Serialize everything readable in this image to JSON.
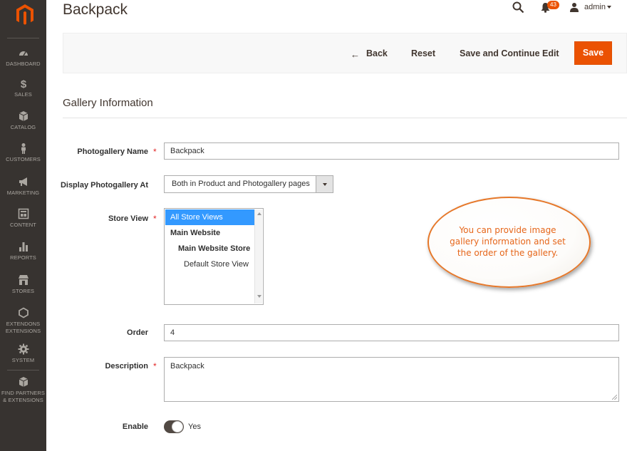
{
  "sidebar": {
    "items": [
      {
        "label": "DASHBOARD",
        "icon": "dashboard-icon"
      },
      {
        "label": "SALES",
        "icon": "dollar-icon"
      },
      {
        "label": "CATALOG",
        "icon": "cube-icon"
      },
      {
        "label": "CUSTOMERS",
        "icon": "person-icon"
      },
      {
        "label": "MARKETING",
        "icon": "megaphone-icon"
      },
      {
        "label": "CONTENT",
        "icon": "layout-icon"
      },
      {
        "label": "REPORTS",
        "icon": "bar-chart-icon"
      },
      {
        "label": "STORES",
        "icon": "store-icon"
      },
      {
        "label": "EXTENDONS",
        "label2": "EXTENSIONS",
        "icon": "hexagon-icon"
      },
      {
        "label": "SYSTEM",
        "icon": "gear-icon"
      },
      {
        "label": "FIND PARTNERS",
        "label2": "& EXTENSIONS",
        "icon": "box-icon"
      }
    ],
    "accent": "#eb5202",
    "background": "#373330"
  },
  "header": {
    "title": "Backpack",
    "notification_count": "43",
    "user": "admin"
  },
  "actions": {
    "back": "Back",
    "reset": "Reset",
    "save_continue": "Save and Continue Edit",
    "save": "Save"
  },
  "section": {
    "title": "Gallery Information"
  },
  "form": {
    "name_label": "Photogallery Name",
    "name_value": "Backpack",
    "display_label": "Display Photogallery At",
    "display_value": "Both in Product and Photogallery pages",
    "store_label": "Store View",
    "store_options": [
      "All Store Views",
      "Main Website",
      "Main Website Store",
      "Default Store View"
    ],
    "order_label": "Order",
    "order_value": "4",
    "description_label": "Description",
    "description_value": "Backpack",
    "enable_label": "Enable",
    "enable_value": "Yes"
  },
  "callout": {
    "text": "You can provide image gallery information and set the order of the gallery."
  }
}
